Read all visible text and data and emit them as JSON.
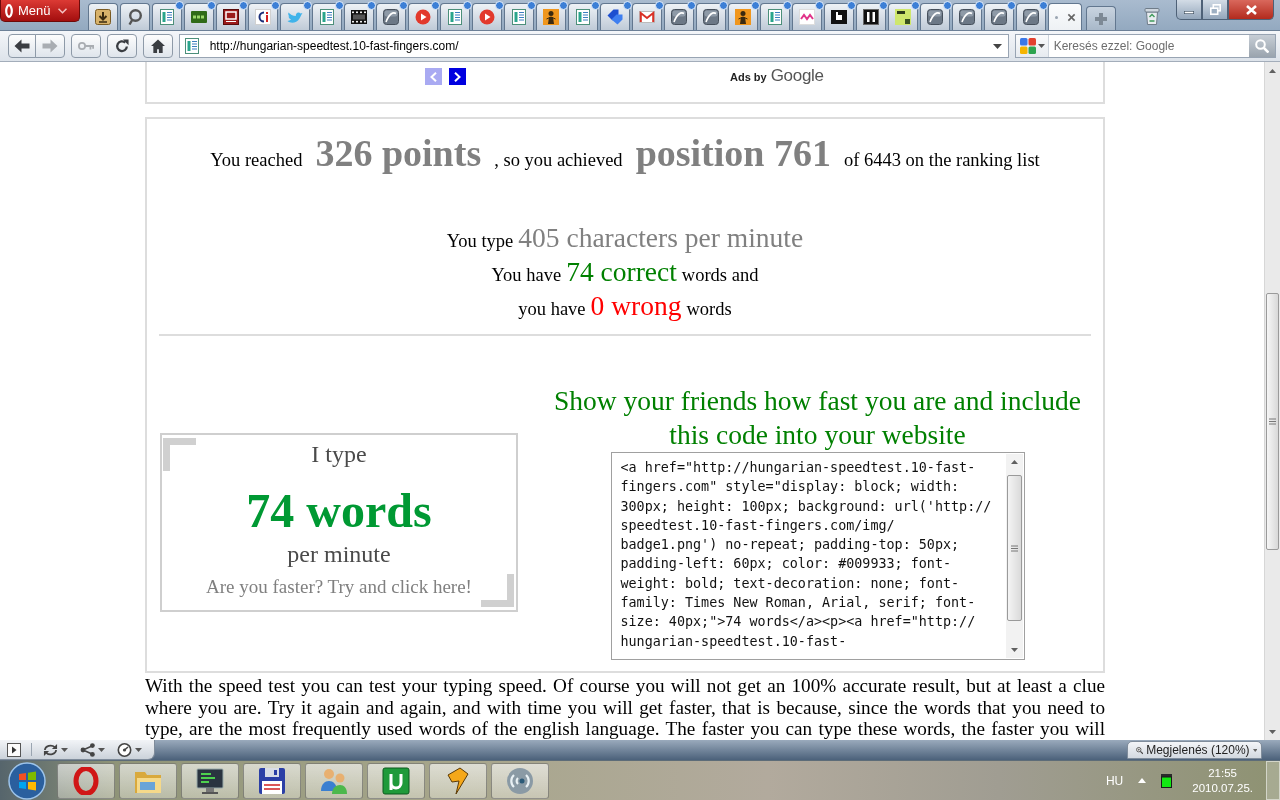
{
  "browser": {
    "menu_label": "Menü",
    "tabs": [
      {
        "kind": "download",
        "selected": false,
        "updated": false
      },
      {
        "kind": "ring",
        "selected": false,
        "updated": false
      },
      {
        "kind": "page",
        "selected": false,
        "updated": true
      },
      {
        "kind": "sms",
        "selected": false,
        "updated": true
      },
      {
        "kind": "bh",
        "selected": false,
        "updated": true
      },
      {
        "kind": "ci",
        "selected": false,
        "updated": true
      },
      {
        "kind": "bird",
        "selected": false,
        "updated": true
      },
      {
        "kind": "page",
        "selected": false,
        "updated": true
      },
      {
        "kind": "film",
        "selected": false,
        "updated": true
      },
      {
        "kind": "script",
        "selected": false,
        "updated": true
      },
      {
        "kind": "play",
        "selected": false,
        "updated": true
      },
      {
        "kind": "page",
        "selected": false,
        "updated": true
      },
      {
        "kind": "play",
        "selected": false,
        "updated": true
      },
      {
        "kind": "page",
        "selected": false,
        "updated": true
      },
      {
        "kind": "figure",
        "selected": false,
        "updated": true
      },
      {
        "kind": "page",
        "selected": false,
        "updated": true
      },
      {
        "kind": "tag",
        "selected": false,
        "updated": true
      },
      {
        "kind": "mail",
        "selected": false,
        "updated": true
      },
      {
        "kind": "script",
        "selected": false,
        "updated": true
      },
      {
        "kind": "script",
        "selected": false,
        "updated": true
      },
      {
        "kind": "figure",
        "selected": false,
        "updated": true
      },
      {
        "kind": "page",
        "selected": false,
        "updated": true
      },
      {
        "kind": "pix",
        "selected": false,
        "updated": true
      },
      {
        "kind": "cube",
        "selected": false,
        "updated": true
      },
      {
        "kind": "stamp",
        "selected": false,
        "updated": true
      },
      {
        "kind": "tz",
        "selected": false,
        "updated": true
      },
      {
        "kind": "script",
        "selected": false,
        "updated": true
      },
      {
        "kind": "script",
        "selected": false,
        "updated": true
      },
      {
        "kind": "script",
        "selected": false,
        "updated": true
      },
      {
        "kind": "script",
        "selected": false,
        "updated": true
      },
      {
        "kind": "blank",
        "selected": true,
        "updated": false
      }
    ],
    "nav_buttons": [
      {
        "kind": "back",
        "disabled": false
      },
      {
        "kind": "forward",
        "disabled": true
      },
      {
        "kind": "key",
        "disabled": true
      },
      {
        "kind": "reload",
        "disabled": false
      },
      {
        "kind": "home",
        "disabled": false
      }
    ],
    "address": {
      "url": "http://hungarian-speedtest.10-fast-fingers.com/"
    },
    "search": {
      "placeholder": "Keresés ezzel: Google"
    }
  },
  "page": {
    "ad_bar": {
      "arrows": [
        {
          "kind": "prev",
          "disabled": true
        },
        {
          "kind": "next",
          "disabled": false
        }
      ],
      "label_prefix": "Ads by",
      "label_brand": "Google"
    },
    "results": {
      "lines": [
        {
          "parts": [
            {
              "kind": "plain",
              "text": "You reached"
            },
            {
              "kind": "big",
              "text": "326 points"
            },
            {
              "kind": "plain",
              "text": ", so you achieved"
            },
            {
              "kind": "big",
              "text": "position 761"
            },
            {
              "kind": "plain",
              "text": "of 6443 on the ranking list"
            }
          ]
        },
        {
          "parts": [
            {
              "kind": "plain",
              "text": "You type"
            },
            {
              "kind": "stat",
              "text": "405 characters per minute"
            }
          ]
        },
        {
          "parts": [
            {
              "kind": "plain",
              "text": "You have"
            },
            {
              "kind": "correct",
              "text": "74 correct"
            },
            {
              "kind": "plain",
              "text": "words and"
            }
          ]
        },
        {
          "parts": [
            {
              "kind": "plain",
              "text": "you have"
            },
            {
              "kind": "wrong",
              "text": "0 wrong"
            },
            {
              "kind": "plain",
              "text": "words"
            }
          ]
        }
      ]
    },
    "share": {
      "badge": {
        "caption": "I type",
        "count": "74 words",
        "unit": "per minute",
        "call_to_action": "Are you faster? Try and click here!"
      },
      "heading": "Show your friends how fast you are and include this code into your website",
      "code_lines": [
        "<a href=\"http://hungarian-speedtest.10-fast-",
        "fingers.com\" style=\"display: block; width:",
        "300px; height: 100px; background: url('http://",
        "speedtest.10-fast-fingers.com/img/",
        "badge1.png') no-repeat; padding-top: 50px;",
        "padding-left: 60px; color: #009933; font-",
        "weight: bold; text-decoration: none; font-",
        "family: Times New Roman, Arial, serif; font-",
        "size: 40px;\">74 words</a><p><a href=\"http://",
        "hungarian-speedtest.10-fast-"
      ]
    },
    "intro_text": "With the speed test you can test your typing speed. Of course you will not get an 100% accurate result, but at least a clue where you are. Try it again and again, and with time you will get faster, that is because, since the words that you need to type, are the most frequently used words of the english language. The faster you can type these words, the faster you will"
  },
  "status_bar": {
    "buttons": [
      {
        "kind": "panel"
      },
      {
        "kind": "sync"
      },
      {
        "kind": "network"
      },
      {
        "kind": "gauge"
      }
    ],
    "zoom_label": "Megjelenés (120%)"
  },
  "taskbar": {
    "apps": [
      {
        "kind": "ring"
      },
      {
        "kind": "folder"
      },
      {
        "kind": "monitor"
      },
      {
        "kind": "floppy"
      },
      {
        "kind": "people"
      },
      {
        "kind": "tile"
      },
      {
        "kind": "bolt"
      },
      {
        "kind": "waves"
      }
    ],
    "language": "HU",
    "time": "21:55",
    "date": "2010.07.25."
  }
}
